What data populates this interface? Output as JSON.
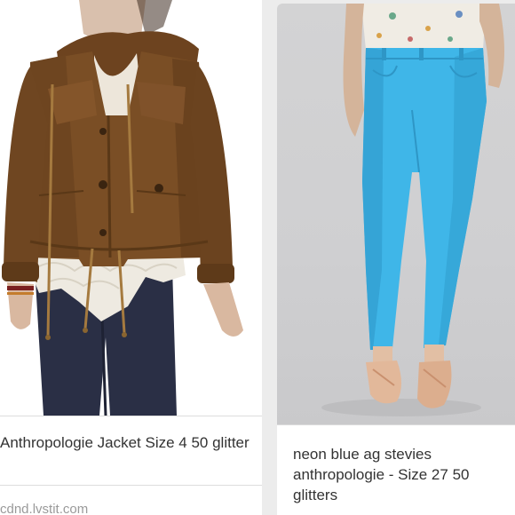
{
  "results": [
    {
      "caption": "Anthropologie Jacket Size 4 50 glitter",
      "source": "cdnd.lvstit.com"
    },
    {
      "caption": "neon blue ag stevies anthropologie - Size 27 50 glitters"
    }
  ],
  "colors": {
    "page_background": "#ececec",
    "card_background": "#ffffff",
    "caption_text": "#333333",
    "source_text": "#9a9a9a",
    "jacket": "#7a4e25",
    "jeans_dark": "#2a2f45",
    "jeans_neon_blue": "#3fb6e8"
  }
}
